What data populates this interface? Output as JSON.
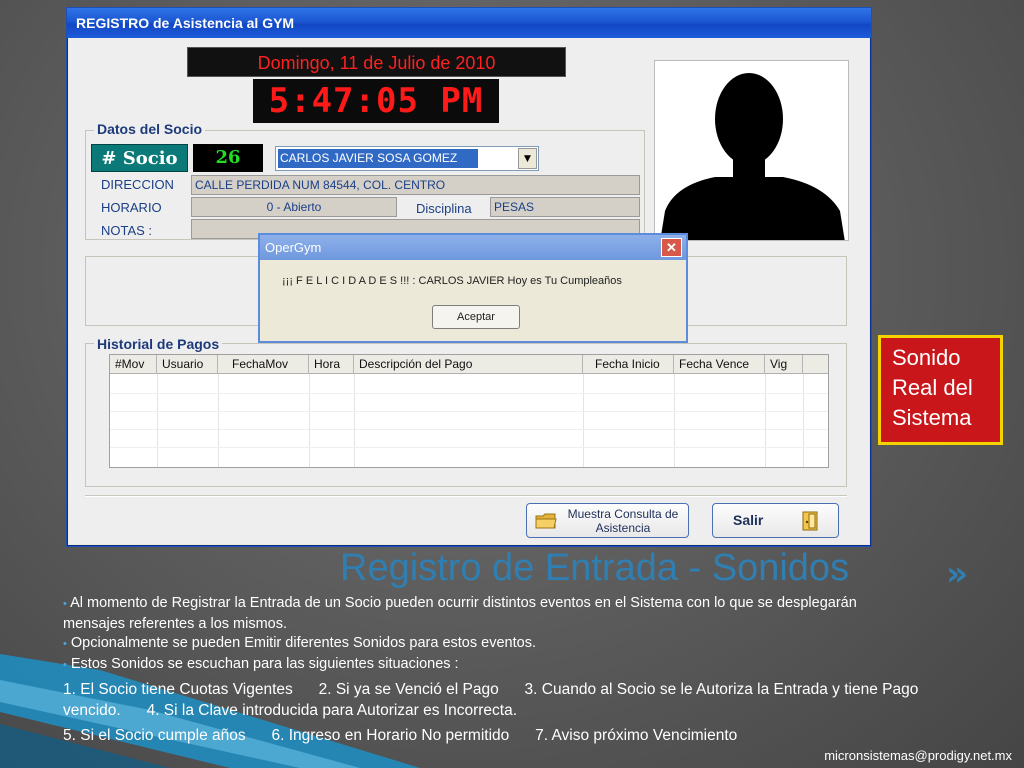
{
  "window": {
    "title": "REGISTRO  de Asistencia al GYM",
    "date_display": "Domingo, 11 de Julio de 2010",
    "time_display": "5:47:05 PM",
    "datos_socio": {
      "legend": "Datos del Socio",
      "socio_label": "# Socio",
      "socio_number": "26",
      "member_name": "CARLOS JAVIER SOSA GOMEZ",
      "direccion_label": "DIRECCION",
      "direccion_value": "CALLE PERDIDA NUM 84544, COL. CENTRO",
      "horario_label": "HORARIO",
      "horario_value": "0 - Abierto",
      "disciplina_label": "Disciplina",
      "disciplina_value": "PESAS",
      "notas_label": "NOTAS :",
      "notas_value": ""
    },
    "historial": {
      "legend": "Historial de Pagos",
      "columns": [
        "#Mov",
        "Usuario",
        "FechaMov",
        "Hora",
        "Descripción del Pago",
        "Fecha Inicio",
        "Fecha Vence",
        "Vig"
      ],
      "rows": []
    },
    "buttons": {
      "consulta": "Muestra Consulta de Asistencia",
      "salir": "Salir"
    }
  },
  "dialog": {
    "title": "OperGym",
    "close": "✕",
    "message": "¡¡¡ F E L I C I D A D E S  !!! :   CARLOS JAVIER  Hoy es Tu Cumpleaños",
    "ok_label": "Aceptar"
  },
  "slide": {
    "callout": "Sonido Real del Sistema",
    "title": "Registro de Entrada - Sonidos",
    "bullets": [
      "Al momento de Registrar la Entrada de un Socio pueden ocurrir distintos eventos en el Sistema con lo que se desplegarán mensajes referentes a los mismos.",
      "Opcionalmente se pueden Emitir diferentes Sonidos para estos eventos.",
      "Estos Sonidos se escuchan para las siguientes situaciones :"
    ],
    "situations_1": "1. El Socio tiene Cuotas Vigentes      2. Si ya se Venció el Pago      3. Cuando al Socio se le Autoriza la Entrada y tiene Pago vencido.      4. Si la Clave introducida para Autorizar es Incorrecta.",
    "situations_2": "5. Si el Socio cumple años      6. Ingreso en Horario No permitido      7. Aviso próximo Vencimiento",
    "footer": "micronsistemas@prodigy.net.mx"
  },
  "colors": {
    "led_text": "#ff2020",
    "titlebar": "#1b57d1",
    "accent_blue": "#2f7fb3",
    "callout_bg": "#c8161a",
    "callout_border": "#f5d300"
  },
  "icons": [
    "close-icon",
    "chevron-down-icon",
    "folder-icon",
    "door-icon",
    "double-chevron-right-icon",
    "silhouette-photo"
  ]
}
